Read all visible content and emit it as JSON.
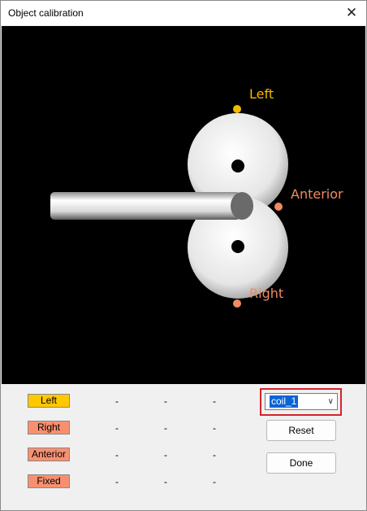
{
  "window": {
    "title": "Object calibration",
    "close_glyph": "✕"
  },
  "viewport": {
    "labels": {
      "left": "Left",
      "anterior": "Anterior",
      "right": "Right"
    },
    "colors": {
      "left": "#f5b800",
      "anterior": "#f08a60",
      "right": "#f08a60",
      "background": "#000000"
    }
  },
  "landmarks": [
    {
      "label": "Left",
      "color": "#ffc800",
      "values": [
        "-",
        "-",
        "-"
      ]
    },
    {
      "label": "Right",
      "color": "#f89070",
      "values": [
        "-",
        "-",
        "-"
      ]
    },
    {
      "label": "Anterior",
      "color": "#f89070",
      "values": [
        "-",
        "-",
        "-"
      ]
    },
    {
      "label": "Fixed",
      "color": "#f89070",
      "values": [
        "-",
        "-",
        "-"
      ]
    }
  ],
  "coil_select": {
    "value": "coil_1",
    "icon": "chevron-down-icon"
  },
  "buttons": {
    "reset": "Reset",
    "done": "Done"
  }
}
